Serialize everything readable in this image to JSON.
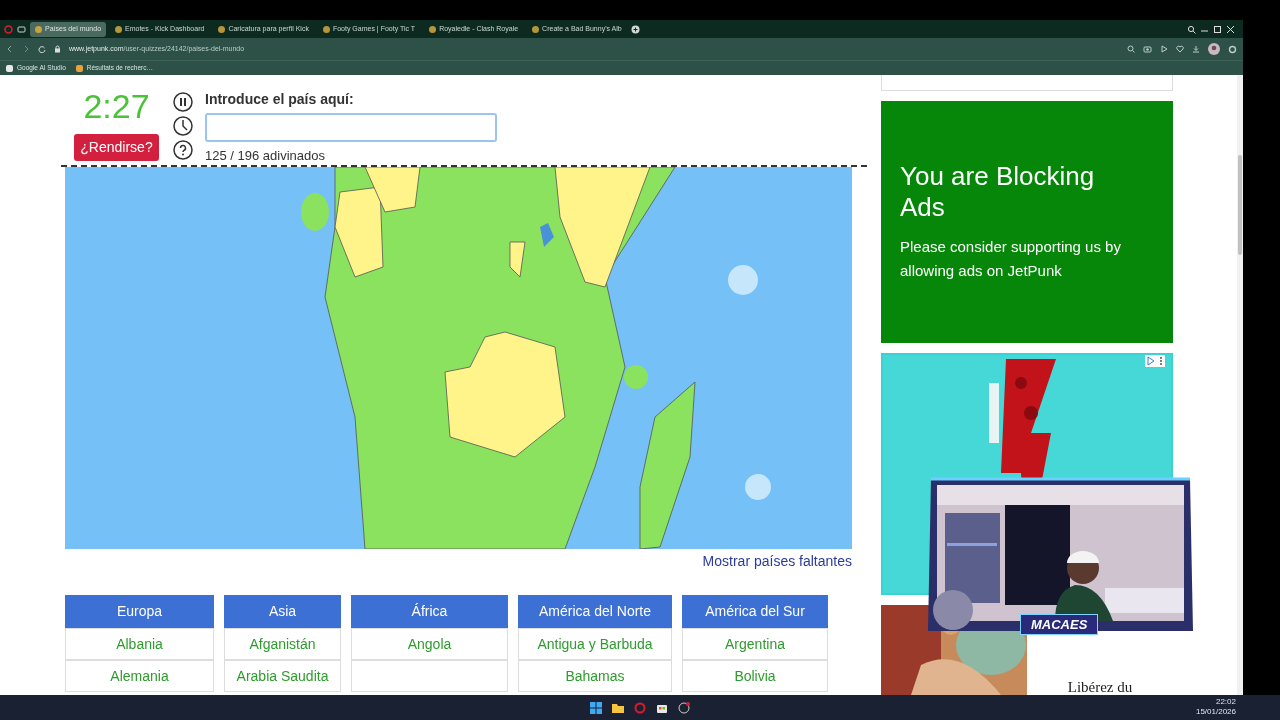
{
  "browser": {
    "tabs": [
      {
        "title": "Países del mundo",
        "selected": true
      },
      {
        "title": "Emotes - Kick Dashboard",
        "selected": false
      },
      {
        "title": "Caricatura para perfil Kick",
        "selected": false
      },
      {
        "title": "Footy Games | Footy Tic T",
        "selected": false
      },
      {
        "title": "Royaledle - Clash Royale",
        "selected": false
      },
      {
        "title": "Create a Bad Bunny's Alb",
        "selected": false
      }
    ],
    "url_host": "www.jetpunk.com",
    "url_path": "/user-quizzes/24142/paises-del-mundo",
    "bookmarks": [
      "Google AI Studio",
      "Résultats de recherc…"
    ]
  },
  "quiz": {
    "timer": "2:27",
    "give_up": "¿Rendirse?",
    "prompt": "Introduce el país aquí:",
    "score": "125 / 196 adivinados",
    "show_missing": "Mostrar países faltantes",
    "columns": [
      {
        "heading": "Europa",
        "cells": [
          "Albania",
          "Alemania"
        ]
      },
      {
        "heading": "Asia",
        "cells": [
          "Afganistán",
          "Arabia Saudita"
        ]
      },
      {
        "heading": "África",
        "cells": [
          "Angola"
        ]
      },
      {
        "heading": "América del Norte",
        "cells": [
          "Antigua y Barbuda",
          "Bahamas"
        ]
      },
      {
        "heading": "América del Sur",
        "cells": [
          "Argentina",
          "Bolivia"
        ]
      }
    ]
  },
  "ads": {
    "title": "You are Blocking Ads",
    "text": "Please consider supporting us by allowing ads on JetPunk",
    "bottom_text": "Libérez du"
  },
  "overlay": {
    "name": "MACAES"
  },
  "taskbar": {
    "time": "22:02",
    "date": "15/01/2026"
  }
}
